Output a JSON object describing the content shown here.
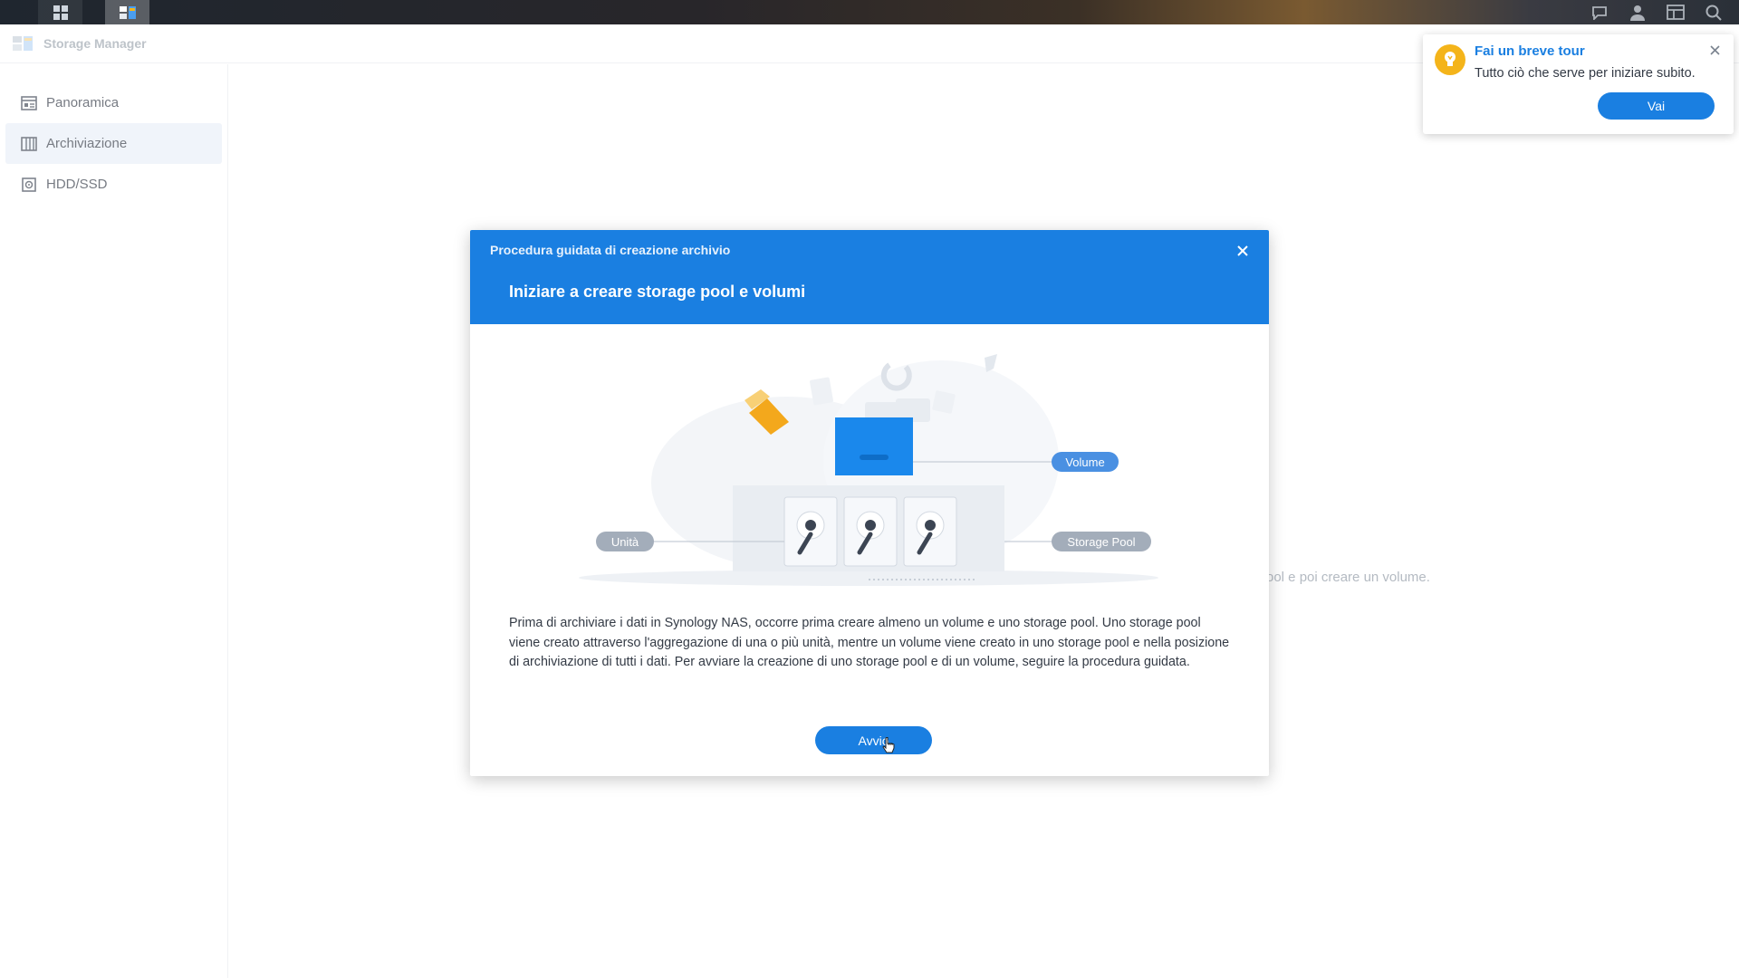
{
  "app": {
    "title": "Storage Manager"
  },
  "sidebar": {
    "items": [
      {
        "label": "Panoramica",
        "icon": "overview-icon",
        "active": false
      },
      {
        "label": "Archiviazione",
        "icon": "storage-icon",
        "active": true
      },
      {
        "label": "HDD/SSD",
        "icon": "disk-icon",
        "active": false
      }
    ]
  },
  "background": {
    "hint_text": "ool e poi creare un volume."
  },
  "wizard": {
    "window_title": "Procedura guidata di creazione archivio",
    "step_title": "Iniziare a creare storage pool e volumi",
    "labels": {
      "volume": "Volume",
      "drive": "Unità",
      "storage_pool": "Storage Pool"
    },
    "description": "Prima di archiviare i dati in Synology NAS, occorre prima creare almeno un volume e uno storage pool. Uno storage pool viene creato attraverso l'aggregazione di una o più unità, mentre un volume viene creato in uno storage pool e nella posizione di archiviazione di tutti i dati. Per avviare la creazione di uno storage pool e di un volume, seguire la procedura guidata.",
    "start_label": "Avvio"
  },
  "tour": {
    "title": "Fai un breve tour",
    "text": "Tutto ciò che serve per iniziare subito.",
    "button_label": "Vai"
  },
  "colors": {
    "accent": "#1a7fe1",
    "tour_bulb": "#f4b41a",
    "pill_label": "#4a90e2",
    "pill_muted": "#a3adba"
  }
}
